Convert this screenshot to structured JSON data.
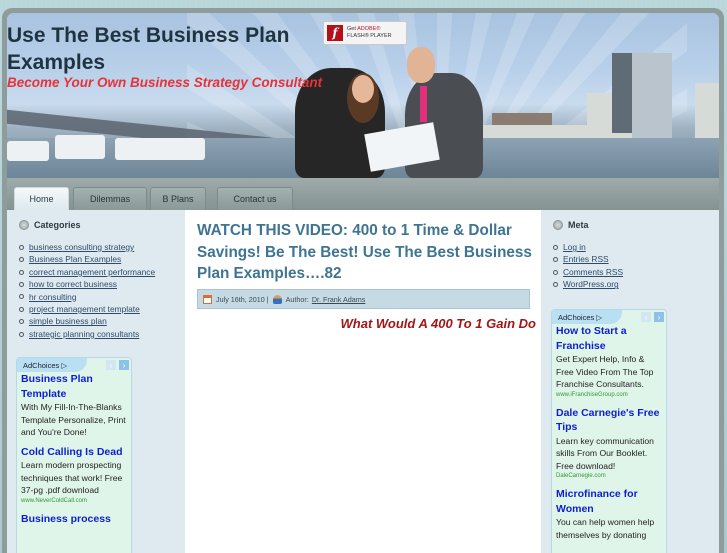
{
  "site": {
    "title": "Use The Best Business Plan Examples",
    "tagline": "Become Your Own Business Strategy Consultant"
  },
  "flash_badge": {
    "line1_prefix": "Get",
    "line1_brand": "ADOBE®",
    "line2": "FLASH® PLAYER",
    "icon": "flash-icon"
  },
  "nav": {
    "tabs": [
      {
        "label": "Home",
        "active": true
      },
      {
        "label": "Dilemmas",
        "active": false
      },
      {
        "label": "B Plans",
        "active": false
      },
      {
        "label": "Contact us",
        "active": false
      }
    ]
  },
  "left_sidebar": {
    "categories": {
      "title": "Categories",
      "items": [
        "business consulting strategy",
        "Business Plan Examples",
        "correct management performance",
        "how to correct business",
        "hr consulting",
        "project management template",
        "simple business plan",
        "strategic planning consultants"
      ]
    },
    "ad": {
      "adchoices_label": "AdChoices ▷",
      "items": [
        {
          "title": "Business Plan Template",
          "desc": "With My Fill-In-The-Blanks Template Personalize, Print and You're Done!",
          "url": ""
        },
        {
          "title": "Cold Calling Is Dead",
          "desc": "Learn modern prospecting techniques that work! Free 37-pg .pdf download",
          "url": "www.NeverColdCall.com"
        },
        {
          "title": "Business process",
          "desc": "",
          "url": ""
        }
      ]
    }
  },
  "right_sidebar": {
    "meta": {
      "title": "Meta",
      "items": [
        "Log in",
        "Entries RSS",
        "Comments RSS",
        "WordPress.org"
      ]
    },
    "ad": {
      "adchoices_label": "AdChoices ▷",
      "items": [
        {
          "title": "How to Start a Franchise",
          "desc": "Get Expert Help, Info & Free Video From The Top Franchise Consultants.",
          "url": "www.iFranchiseGroup.com"
        },
        {
          "title": "Dale Carnegie's Free Tips",
          "desc": "Learn key communication skills From Our Booklet. Free download!",
          "url": "DaleCarnegie.com"
        },
        {
          "title": "Microfinance for Women",
          "desc": "You can help women help themselves by donating",
          "url": ""
        }
      ]
    }
  },
  "post": {
    "title": "WATCH THIS VIDEO: 400 to 1 Time & Dollar Savings! Be The Best! Use The Best Business Plan Examples….82",
    "date": "July 16th, 2010 |",
    "author_label": "Author:",
    "author_name": "Dr. Frank Adams",
    "subheading": "What Would A 400 To 1 Gain Do"
  },
  "colors": {
    "title": "#1f3440",
    "tagline": "#e8323a",
    "post_title": "#3f7492",
    "subheading": "#a11616",
    "ad_link": "#0b1fd0",
    "ad_url": "#2f9a2f",
    "sidebar_bg": "#dfeaf0"
  }
}
